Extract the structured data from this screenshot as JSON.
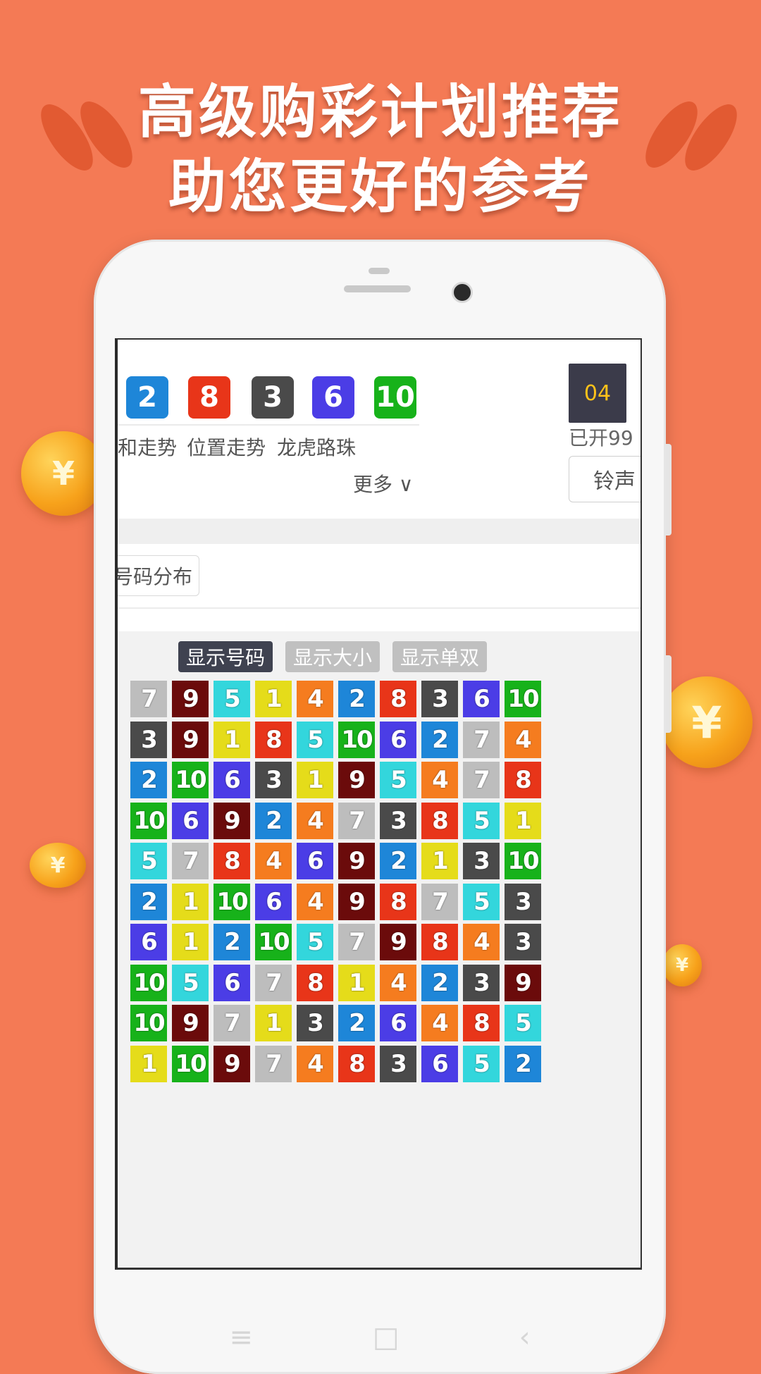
{
  "headline": {
    "line1": "高级购彩计划推荐",
    "line2": "助您更好的参考"
  },
  "colors": {
    "background": "#f47a55",
    "num_1": "#e5dc1a",
    "num_2": "#1e86d8",
    "num_3": "#4a4a4a",
    "num_4": "#f57c1f",
    "num_5": "#33d6dc",
    "num_6": "#4b3de6",
    "num_7": "#bdbdbd",
    "num_8": "#e83519",
    "num_9": "#6b0b0b",
    "num_10": "#17b21a"
  },
  "coin_symbol": "¥",
  "latest_draw": {
    "numbers": [
      2,
      8,
      3,
      6,
      10
    ],
    "issue": "04",
    "issue_text": "已开99",
    "ring_label": "铃声"
  },
  "links": [
    "和走势",
    "位置走势",
    "龙虎路珠"
  ],
  "more_label": "更多 ∨",
  "distribution_button": "号码分布",
  "toggles": {
    "show_number": "显示号码",
    "show_size": "显示大小",
    "show_oddeven": "显示单双"
  },
  "history_rows": [
    [
      7,
      9,
      5,
      1,
      4,
      2,
      8,
      3,
      6,
      10
    ],
    [
      3,
      9,
      1,
      8,
      5,
      10,
      6,
      2,
      7,
      4
    ],
    [
      2,
      10,
      6,
      3,
      1,
      9,
      5,
      4,
      7,
      8
    ],
    [
      10,
      6,
      9,
      2,
      4,
      7,
      3,
      8,
      5,
      1
    ],
    [
      5,
      7,
      8,
      4,
      6,
      9,
      2,
      1,
      3,
      10
    ],
    [
      2,
      1,
      10,
      6,
      4,
      9,
      8,
      7,
      5,
      3
    ],
    [
      6,
      1,
      2,
      10,
      5,
      7,
      9,
      8,
      4,
      3
    ],
    [
      10,
      5,
      6,
      7,
      8,
      1,
      4,
      2,
      3,
      9
    ],
    [
      10,
      9,
      7,
      1,
      3,
      2,
      6,
      4,
      8,
      5
    ],
    [
      1,
      10,
      9,
      7,
      4,
      8,
      3,
      6,
      5,
      2
    ]
  ]
}
